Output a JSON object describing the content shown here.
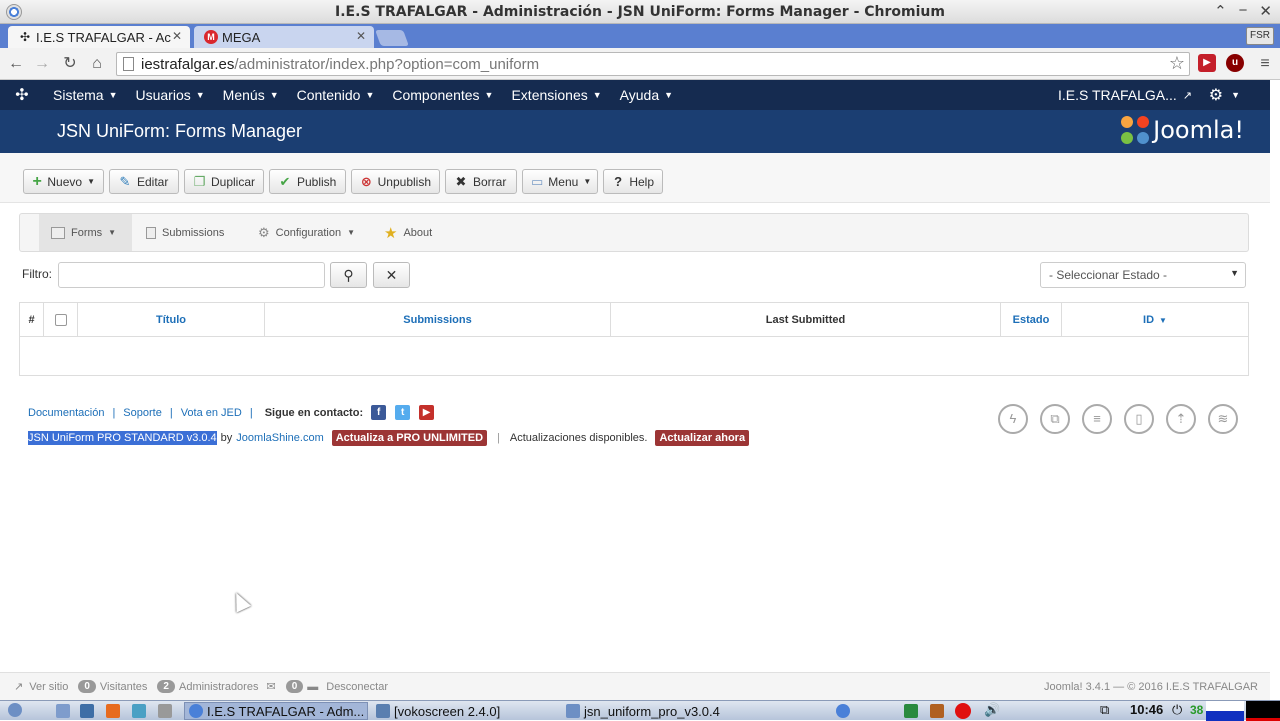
{
  "window": {
    "title": "I.E.S TRAFALGAR - Administración - JSN UniForm: Forms Manager - Chromium",
    "buttons": [
      "⌃",
      "−",
      "✕"
    ]
  },
  "tabs": [
    {
      "label": "I.E.S TRAFALGAR - Ac",
      "active": true
    },
    {
      "label": "MEGA",
      "active": false
    }
  ],
  "profile_badge": "FSR",
  "address": {
    "host": "iestrafalgar.es",
    "path": "/administrator/index.php?option=com_uniform"
  },
  "joomla_nav": {
    "items": [
      "Sistema",
      "Usuarios",
      "Menús",
      "Contenido",
      "Componentes",
      "Extensiones",
      "Ayuda"
    ],
    "site_name": "I.E.S TRAFALGA..."
  },
  "header": {
    "page_title": "JSN UniForm: Forms Manager",
    "logo_text": "Joomla!"
  },
  "toolbar": {
    "nuevo": "Nuevo",
    "editar": "Editar",
    "duplicar": "Duplicar",
    "publish": "Publish",
    "unpublish": "Unpublish",
    "borrar": "Borrar",
    "menu": "Menu",
    "help": "Help"
  },
  "subnav": {
    "forms": "Forms",
    "submissions": "Submissions",
    "configuration": "Configuration",
    "about": "About"
  },
  "filter": {
    "label": "Filtro:",
    "state_select": "- Seleccionar Estado -"
  },
  "table": {
    "columns": {
      "number": "#",
      "title": "Título",
      "submissions": "Submissions",
      "last_submitted": "Last Submitted",
      "state": "Estado",
      "id": "ID"
    }
  },
  "footer_links": {
    "documentacion": "Documentación",
    "soporte": "Soporte",
    "vota": "Vota en JED",
    "contacto": "Sigue en contacto:"
  },
  "version": {
    "product": "JSN UniForm PRO STANDARD v3.0.4",
    "by": "by",
    "vendor": "JoomlaShine.com",
    "upgrade_badge": "Actualiza a PRO UNLIMITED",
    "updates_text": "Actualizaciones disponibles.",
    "update_now": "Actualizar ahora"
  },
  "statusbar": {
    "ver_sitio": "Ver sitio",
    "visitantes_count": "0",
    "visitantes": "Visitantes",
    "admins_count": "2",
    "admins": "Administradores",
    "mail_count": "0",
    "desconectar": "Desconectar",
    "copyright": "Joomla! 3.4.1 — © 2016 I.E.S TRAFALGAR"
  },
  "taskbar": {
    "items": [
      "I.E.S TRAFALGAR - Adm...",
      "[vokoscreen 2.4.0]",
      "jsn_uniform_pro_v3.0.4"
    ],
    "clock": "10:46",
    "battery": "38"
  },
  "colors": {
    "nav_bg": "#152b50",
    "header_bg": "#1b3e72",
    "link": "#1d6fb8",
    "badge_red": "#9c3535"
  }
}
